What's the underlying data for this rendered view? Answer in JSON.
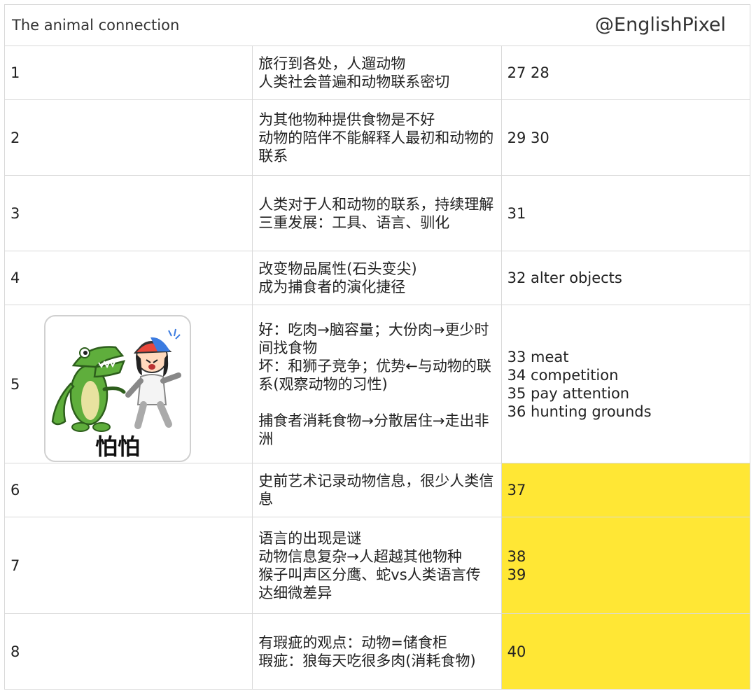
{
  "header": {
    "title": "The animal connection",
    "handle": "@EnglishPixel"
  },
  "sticker": {
    "caption": "怕怕",
    "icon": "crocodile-scaring-kid-sticker"
  },
  "colors": {
    "highlight": "#ffe735",
    "border": "#d9d9d9"
  },
  "rows": [
    {
      "num": "1",
      "notes": [
        "旅行到各处，人遛动物",
        "人类社会普遍和动物联系密切"
      ],
      "answers": [
        "27 28"
      ],
      "highlight": false
    },
    {
      "num": "2",
      "notes": [
        "为其他物种提供食物是不好",
        "动物的陪伴不能解释人最初和动物的联系"
      ],
      "answers": [
        "29 30"
      ],
      "highlight": false
    },
    {
      "num": "3",
      "notes": [
        "人类对于人和动物的联系，持续理解",
        "三重发展：工具、语言、驯化"
      ],
      "answers": [
        "31"
      ],
      "highlight": false
    },
    {
      "num": "4",
      "notes": [
        "改变物品属性(石头变尖)",
        "成为捕食者的演化捷径"
      ],
      "answers": [
        "32 alter objects"
      ],
      "highlight": false
    },
    {
      "num": "5",
      "notes": [
        "好：吃肉→脑容量；大份肉→更少时间找食物",
        "坏：和狮子竞争；优势←与动物的联系(观察动物的习性)",
        "",
        "捕食者消耗食物→分散居住→走出非洲"
      ],
      "answers": [
        "33 meat",
        "34 competition",
        "35 pay attention",
        "36 hunting grounds"
      ],
      "highlight": false
    },
    {
      "num": "6",
      "notes": [
        "史前艺术记录动物信息，很少人类信息"
      ],
      "answers": [
        "37"
      ],
      "highlight": true
    },
    {
      "num": "7",
      "notes": [
        "语言的出现是谜",
        "动物信息复杂→人超越其他物种",
        "猴子叫声区分鹰、蛇vs人类语言传达细微差异"
      ],
      "answers": [
        "38",
        "39"
      ],
      "highlight": true
    },
    {
      "num": "8",
      "notes": [
        "有瑕疵的观点：动物=储食柜",
        "瑕疵：狼每天吃很多肉(消耗食物)"
      ],
      "answers": [
        "40"
      ],
      "highlight": true
    }
  ]
}
